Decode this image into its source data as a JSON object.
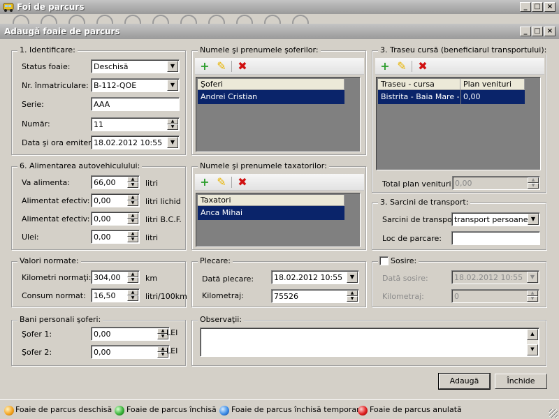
{
  "main_window": {
    "title": "Foi de parcurs",
    "min": "_",
    "max": "□",
    "close": "×"
  },
  "dialog": {
    "title": "Adaugă foaie de parcurs",
    "min": "_",
    "max": "□",
    "close": "×"
  },
  "identificare": {
    "legend": "1. Identificare:",
    "status_label": "Status foaie:",
    "status_value": "Deschisă",
    "nr_label": "Nr. înmatriculare:",
    "nr_value": "B-112-QOE",
    "serie_label": "Serie:",
    "serie_value": "AAA",
    "numar_label": "Număr:",
    "numar_value": "11",
    "data_label": "Data şi ora emiterii:",
    "data_value": "18.02.2012 10:55"
  },
  "soferi": {
    "legend": "Numele şi prenumele şoferilor:",
    "header": "Şoferi",
    "rows": [
      "Andrei Cristian"
    ]
  },
  "taxatori": {
    "legend": "Numele şi prenumele taxatorilor:",
    "header": "Taxatori",
    "rows": [
      "Anca Mihai"
    ]
  },
  "traseu": {
    "legend": "3. Traseu cursă (beneficiarul transportului):",
    "col1": "Traseu - cursa",
    "col2": "Plan venituri",
    "rows": [
      {
        "traseu": "Bistrita - Baia Mare - ...",
        "plan": "0,00"
      }
    ],
    "total_label": "Total plan venituri:",
    "total_value": "0,00"
  },
  "alimentare": {
    "legend": "6. Alimentarea autovehiculului:",
    "va_label": "Va alimenta:",
    "va_value": "66,00",
    "va_unit": "litri",
    "ef_label": "Alimentat efectiv:",
    "ef_value": "0,00",
    "ef_unit": "litri lichid",
    "bcf_label": "Alimentat efectiv:",
    "bcf_value": "0,00",
    "bcf_unit": "litri B.C.F.",
    "ulei_label": "Ulei:",
    "ulei_value": "0,00",
    "ulei_unit": "litri"
  },
  "sarcini": {
    "legend": "3. Sarcini de transport:",
    "sarcini_label": "Sarcini de transport:",
    "sarcini_value": "transport persoane",
    "loc_label": "Loc de parcare:",
    "loc_value": ""
  },
  "valori": {
    "legend": "Valori normate:",
    "km_label": "Kilometri normaţi:",
    "km_value": "304,00",
    "km_unit": "km",
    "consum_label": "Consum normat:",
    "consum_value": "16,50",
    "consum_unit": "litri/100km"
  },
  "plecare": {
    "legend": "Plecare:",
    "data_label": "Dată plecare:",
    "data_value": "18.02.2012 10:55",
    "km_label": "Kilometraj:",
    "km_value": "75526"
  },
  "sosire": {
    "legend": "Sosire:",
    "data_label": "Dată sosire:",
    "data_value": "18.02.2012 10:55",
    "km_label": "Kilometraj:",
    "km_value": "0"
  },
  "bani": {
    "legend": "Bani personali şoferi:",
    "s1_label": "Şofer 1:",
    "s1_value": "0,00",
    "s1_unit": "LEI",
    "s2_label": "Şofer 2:",
    "s2_value": "0,00",
    "s2_unit": "LEI"
  },
  "observatii": {
    "legend": "Observaţii:",
    "value": ""
  },
  "buttons": {
    "add": "Adaugă",
    "close": "Închide"
  },
  "status_bar": {
    "items": [
      {
        "label": "Foaie de parcus deschisă",
        "color": "#f5a623"
      },
      {
        "label": "Foaie de parcus închisă",
        "color": "#3cb43c"
      },
      {
        "label": "Foaie de parcus închisă temporar",
        "color": "#3c8ce6"
      },
      {
        "label": "Foaie de parcus anulată",
        "color": "#e02020"
      }
    ]
  },
  "icons": {
    "add": "plus-icon",
    "edit": "pencil-icon",
    "delete": "delete-x-icon"
  },
  "accent_colors": {
    "selection": "#0a246a",
    "add": "#2e9e2e",
    "edit": "#e8b400",
    "delete": "#d01010"
  }
}
